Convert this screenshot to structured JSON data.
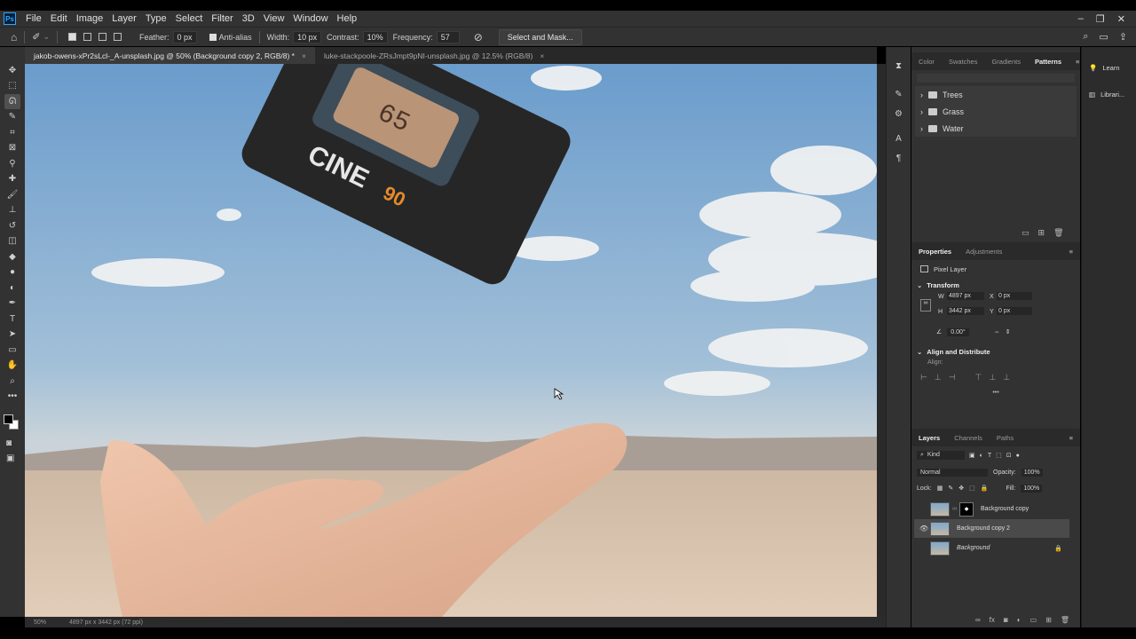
{
  "app": {
    "logo": "Ps"
  },
  "menu": [
    "File",
    "Edit",
    "Image",
    "Layer",
    "Type",
    "Select",
    "Filter",
    "3D",
    "View",
    "Window",
    "Help"
  ],
  "window_controls": {
    "minimize": "–",
    "restore": "❐",
    "close": "✕"
  },
  "options_bar": {
    "feather_label": "Feather:",
    "feather_value": "0 px",
    "antialias_label": "Anti-alias",
    "width_label": "Width:",
    "width_value": "10 px",
    "contrast_label": "Contrast:",
    "contrast_value": "10%",
    "frequency_label": "Frequency:",
    "frequency_value": "57",
    "select_mask_label": "Select and Mask..."
  },
  "tabs": [
    {
      "label": "jakob-owens-xPr2sLcl-_A-unsplash.jpg @ 50% (Background copy 2, RGB/8) *",
      "active": true
    },
    {
      "label": "luke-stackpoole-ZRsJmpt9pNI-unsplash.jpg @ 12.5% (RGB/8)",
      "active": false
    }
  ],
  "image": {
    "product_text": "CINE",
    "product_number": "90",
    "counter": "65"
  },
  "status": {
    "zoom": "50%",
    "doc_info": "4897 px x 3442 px (72 ppi)"
  },
  "patterns_panel": {
    "tabs": [
      "Color",
      "Swatches",
      "Gradients",
      "Patterns"
    ],
    "active_tab": "Patterns",
    "groups": [
      "Trees",
      "Grass",
      "Water"
    ]
  },
  "learn_panel": {
    "learn": "Learn",
    "libraries": "Librari..."
  },
  "properties_panel": {
    "tabs": [
      "Properties",
      "Adjustments"
    ],
    "layer_type": "Pixel Layer",
    "transform_title": "Transform",
    "w_label": "W",
    "w_value": "4897 px",
    "h_label": "H",
    "h_value": "3442 px",
    "x_label": "X",
    "x_value": "0 px",
    "y_label": "Y",
    "y_value": "0 px",
    "angle_value": "0.00°",
    "align_title": "Align and Distribute",
    "align_label": "Align:",
    "more": "•••"
  },
  "layers_panel": {
    "tabs": [
      "Layers",
      "Channels",
      "Paths"
    ],
    "kind_label": "Kind",
    "blend_mode": "Normal",
    "opacity_label": "Opacity:",
    "opacity_value": "100%",
    "lock_label": "Lock:",
    "fill_label": "Fill:",
    "fill_value": "100%",
    "layers": [
      {
        "name": "Background copy",
        "visible": false,
        "selected": false
      },
      {
        "name": "Background copy 2",
        "visible": true,
        "selected": true
      },
      {
        "name": "Background",
        "visible": false,
        "selected": false
      }
    ]
  },
  "colors": {
    "accent": "#31a8ff",
    "panel": "#323232",
    "dark": "#262626"
  }
}
